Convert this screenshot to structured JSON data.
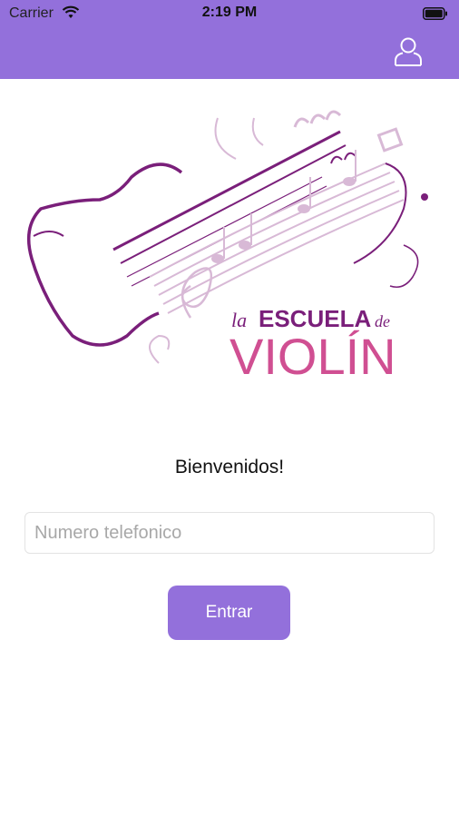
{
  "colors": {
    "accent": "#9370db",
    "logo_dark_purple": "#7a1f7a",
    "logo_pink": "#d04f92",
    "logo_light": "#d8b9d6"
  },
  "status_bar": {
    "carrier": "Carrier",
    "time": "2:19 PM",
    "wifi_icon": "wifi-icon",
    "battery_icon": "battery-icon"
  },
  "header": {
    "profile_icon": "user-profile-icon"
  },
  "logo": {
    "line1_la": "la",
    "line1_escuela": "ESCUELA",
    "line1_de": "de",
    "line2": "VIOLÍN"
  },
  "welcome_text": "Bienvenidos!",
  "phone_input": {
    "placeholder": "Numero telefonico",
    "value": ""
  },
  "enter_button": {
    "label": "Entrar"
  }
}
